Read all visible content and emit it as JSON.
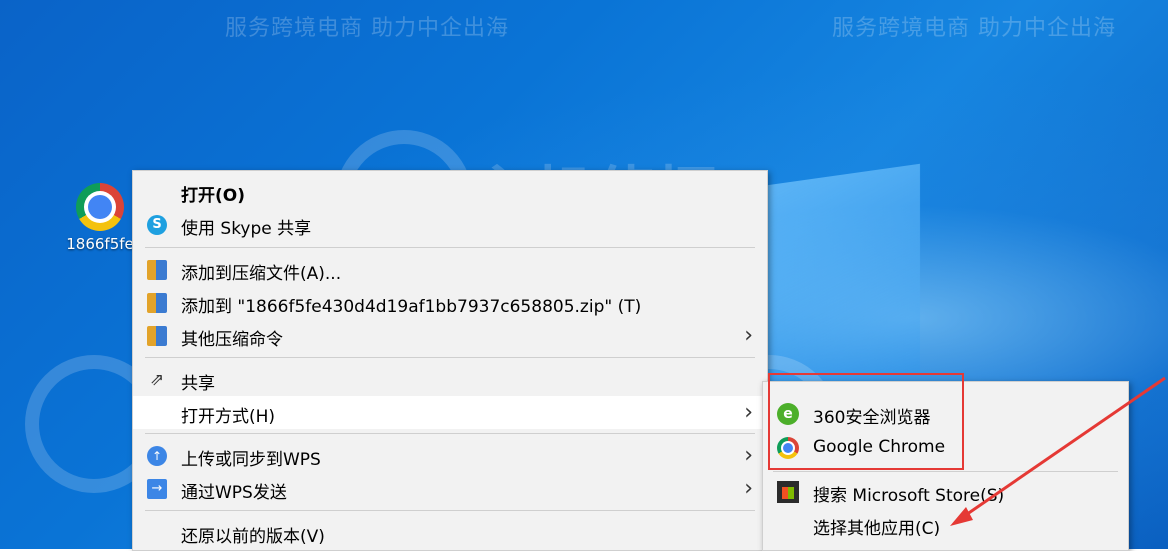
{
  "desktop": {
    "icon_label": "1866f5fe",
    "watermark_text": "服务跨境电商 助力中企出海",
    "watermark_logo": "主机侦探"
  },
  "context_menu": {
    "items": [
      {
        "label": "打开(O)",
        "icon": "none"
      },
      {
        "label": "使用 Skype 共享",
        "icon": "skype-icon"
      },
      {
        "label": "添加到压缩文件(A)...",
        "icon": "archive-icon"
      },
      {
        "label": "添加到 \"1866f5fe430d4d19af1bb7937c658805.zip\" (T)",
        "icon": "archive-icon"
      },
      {
        "label": "其他压缩命令",
        "icon": "archive-icon",
        "arrow": "›"
      },
      {
        "label": "共享",
        "icon": "share-icon"
      },
      {
        "label": "打开方式(H)",
        "icon": "none",
        "arrow": "›"
      },
      {
        "label": "上传或同步到WPS",
        "icon": "cloud-upload-icon",
        "arrow": "›"
      },
      {
        "label": "通过WPS发送",
        "icon": "send-icon",
        "arrow": "›"
      },
      {
        "label": "还原以前的版本(V)",
        "icon": "none"
      }
    ]
  },
  "open_with_submenu": {
    "items": [
      {
        "label": "360安全浏览器",
        "icon": "360-browser-icon"
      },
      {
        "label": "Google Chrome",
        "icon": "chrome-icon"
      },
      {
        "label": "搜索 Microsoft Store(S)",
        "icon": "microsoft-store-icon"
      },
      {
        "label": "选择其他应用(C)",
        "icon": "none"
      }
    ]
  },
  "colors": {
    "highlight_box": "#e53935",
    "arrow": "#e53935",
    "desktop_blue": "#0a6cd0"
  }
}
